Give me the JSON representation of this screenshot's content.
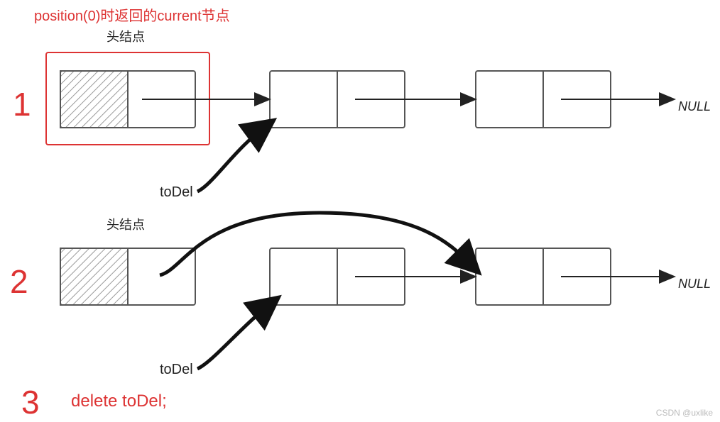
{
  "title": "position(0)时返回的current节点",
  "head_label": "头结点",
  "null_label": "NULL",
  "todel_label": "toDel",
  "step1": "1",
  "step2": "2",
  "step3": "3",
  "delete_stmt": "delete toDel;",
  "watermark": "CSDN @uxlike",
  "colors": {
    "red": "#d33333",
    "black": "#222222",
    "hatch": "#9a9a9a",
    "box": "#555555"
  },
  "diagram": {
    "rows": [
      {
        "id": 1,
        "head_highlight": true,
        "nodes": 3,
        "todel_points_to_node": 2,
        "skip_arrow": false
      },
      {
        "id": 2,
        "head_highlight": false,
        "nodes": 3,
        "todel_points_to_node": 2,
        "skip_arrow": true
      }
    ]
  }
}
